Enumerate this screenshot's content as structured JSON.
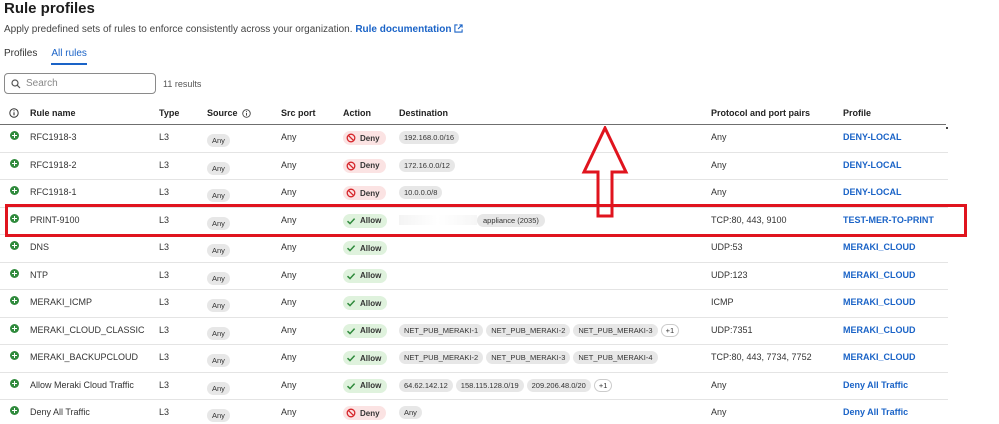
{
  "page": {
    "title": "Rule profiles",
    "subtitle": "Apply predefined sets of rules to enforce consistently across your organization.",
    "doc_link": "Rule documentation"
  },
  "tabs": [
    {
      "label": "Profiles",
      "active": false
    },
    {
      "label": "All rules",
      "active": true
    }
  ],
  "search": {
    "placeholder": "Search",
    "value": ""
  },
  "results": "11 results",
  "columns": {
    "rule_name": "Rule name",
    "type": "Type",
    "source": "Source",
    "src_port": "Src port",
    "action": "Action",
    "destination": "Destination",
    "protocol": "Protocol and port pairs",
    "profile": "Profile"
  },
  "rows": [
    {
      "name": "RFC1918-3",
      "type": "L3",
      "source": "Any",
      "src_port": "Any",
      "action": "Deny",
      "destination": [
        "192.168.0.0/16"
      ],
      "protocol": "Any",
      "profile": "DENY-LOCAL"
    },
    {
      "name": "RFC1918-2",
      "type": "L3",
      "source": "Any",
      "src_port": "Any",
      "action": "Deny",
      "destination": [
        "172.16.0.0/12"
      ],
      "protocol": "Any",
      "profile": "DENY-LOCAL"
    },
    {
      "name": "RFC1918-1",
      "type": "L3",
      "source": "Any",
      "src_port": "Any",
      "action": "Deny",
      "destination": [
        "10.0.0.0/8"
      ],
      "protocol": "Any",
      "profile": "DENY-LOCAL"
    },
    {
      "name": "PRINT-9100",
      "type": "L3",
      "source": "Any",
      "src_port": "Any",
      "action": "Allow",
      "destination": [
        "appliance (2035)"
      ],
      "protocol": "TCP:80, 443, 9100",
      "profile": "TEST-MER-TO-PRINT"
    },
    {
      "name": "DNS",
      "type": "L3",
      "source": "Any",
      "src_port": "Any",
      "action": "Allow",
      "destination": [],
      "protocol": "UDP:53",
      "profile": "MERAKI_CLOUD"
    },
    {
      "name": "NTP",
      "type": "L3",
      "source": "Any",
      "src_port": "Any",
      "action": "Allow",
      "destination": [],
      "protocol": "UDP:123",
      "profile": "MERAKI_CLOUD"
    },
    {
      "name": "MERAKI_ICMP",
      "type": "L3",
      "source": "Any",
      "src_port": "Any",
      "action": "Allow",
      "destination": [],
      "protocol": "ICMP",
      "profile": "MERAKI_CLOUD"
    },
    {
      "name": "MERAKI_CLOUD_CLASSIC",
      "type": "L3",
      "source": "Any",
      "src_port": "Any",
      "action": "Allow",
      "destination": [
        "NET_PUB_MERAKI-1",
        "NET_PUB_MERAKI-2",
        "NET_PUB_MERAKI-3",
        "+1"
      ],
      "protocol": "UDP:7351",
      "profile": "MERAKI_CLOUD"
    },
    {
      "name": "MERAKI_BACKUPCLOUD",
      "type": "L3",
      "source": "Any",
      "src_port": "Any",
      "action": "Allow",
      "destination": [
        "NET_PUB_MERAKI-2",
        "NET_PUB_MERAKI-3",
        "NET_PUB_MERAKI-4"
      ],
      "protocol": "TCP:80, 443, 7734, 7752",
      "profile": "MERAKI_CLOUD"
    },
    {
      "name": "Allow Meraki Cloud Traffic",
      "type": "L3",
      "source": "Any",
      "src_port": "Any",
      "action": "Allow",
      "destination": [
        "64.62.142.12",
        "158.115.128.0/19",
        "209.206.48.0/20",
        "+1"
      ],
      "protocol": "Any",
      "profile": "Deny All Traffic"
    },
    {
      "name": "Deny All Traffic",
      "type": "L3",
      "source": "Any",
      "src_port": "Any",
      "action": "Deny",
      "destination": [
        "Any"
      ],
      "protocol": "Any",
      "profile": "Deny All Traffic"
    }
  ],
  "colors": {
    "accent": "#1a63c7",
    "deny_bg": "#fbe3e3",
    "allow_bg": "#dff2dd",
    "annotation": "#e0141e"
  }
}
